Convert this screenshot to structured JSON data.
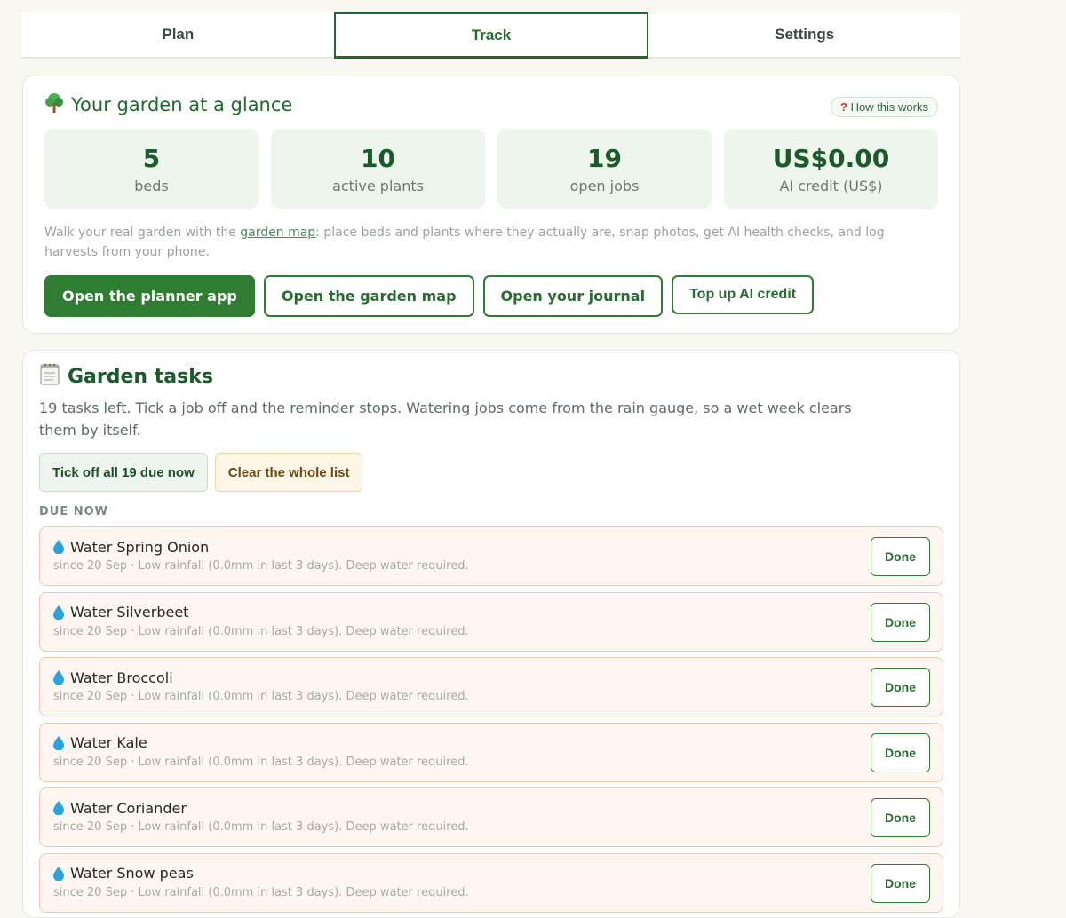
{
  "tabs": [
    {
      "label": "Plan"
    },
    {
      "label": "Track"
    },
    {
      "label": "Settings"
    }
  ],
  "active_tab": "Track",
  "glance": {
    "icon": "tree-icon",
    "title": "Your garden at a glance",
    "help_label": "How this works",
    "stats": [
      {
        "value": "5",
        "label": "beds"
      },
      {
        "value": "10",
        "label": "active plants"
      },
      {
        "value": "19",
        "label": "open jobs"
      },
      {
        "value": "US$0.00",
        "label": "AI credit (US$)"
      }
    ],
    "desc_before": "Walk your real garden with the ",
    "desc_link": "garden map",
    "desc_after": ": place beds and plants where they actually are, snap photos, get AI health checks, and log harvests from your phone.",
    "buttons": {
      "planner": "Open the planner app",
      "map": "Open the garden map",
      "journal": "Open your journal",
      "topup": "Top up AI credit"
    }
  },
  "tasks": {
    "icon": "notepad-icon",
    "title": "Garden tasks",
    "desc": "19 tasks left. Tick a job off and the reminder stops. Watering jobs come from the rain gauge, so a wet week clears them by itself.",
    "tick_all_label": "Tick off all 19 due now",
    "clear_label": "Clear the whole list",
    "section_label": "DUE NOW",
    "done_label": "Done",
    "items": [
      {
        "name": "Water Spring Onion",
        "meta": "since 20 Sep · Low rainfall (0.0mm in last 3 days). Deep water required."
      },
      {
        "name": "Water Silverbeet",
        "meta": "since 20 Sep · Low rainfall (0.0mm in last 3 days). Deep water required."
      },
      {
        "name": "Water Broccoli",
        "meta": "since 20 Sep · Low rainfall (0.0mm in last 3 days). Deep water required."
      },
      {
        "name": "Water Kale",
        "meta": "since 20 Sep · Low rainfall (0.0mm in last 3 days). Deep water required."
      },
      {
        "name": "Water Coriander",
        "meta": "since 20 Sep · Low rainfall (0.0mm in last 3 days). Deep water required."
      },
      {
        "name": "Water Snow peas",
        "meta": "since 20 Sep · Low rainfall (0.0mm in last 3 days). Deep water required."
      }
    ]
  },
  "colors": {
    "brand_green": "#2e7d32",
    "task_bg": "#fff6f1",
    "task_border": "#f1c8b3"
  }
}
